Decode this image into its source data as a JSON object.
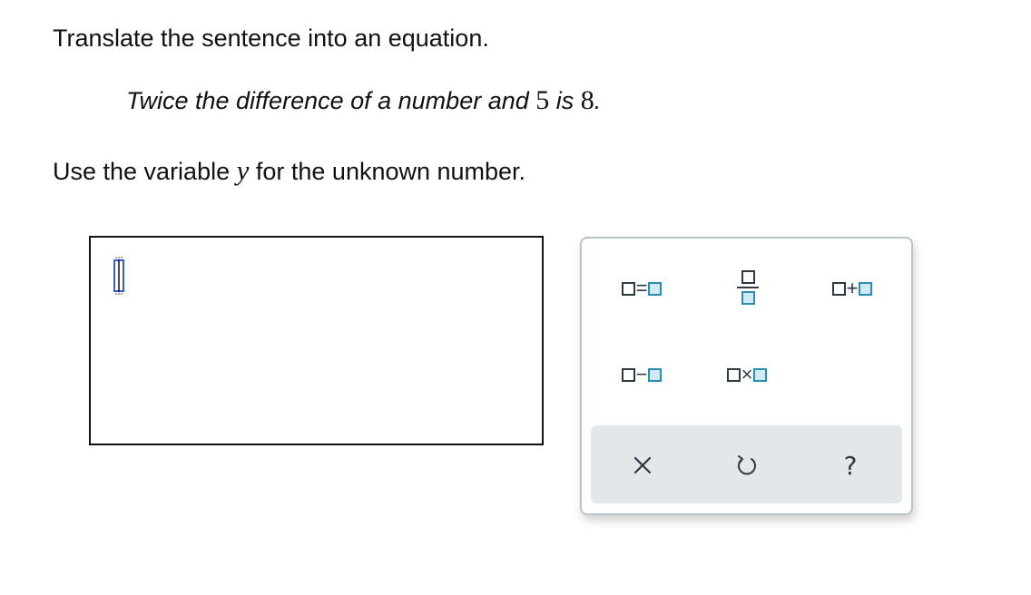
{
  "question": {
    "instruction": "Translate the sentence into an equation.",
    "sentence": {
      "part1": "Twice the difference of a number and ",
      "num1": "5",
      "part2": " is ",
      "num2": "8",
      "part3": "."
    },
    "variable_instruction": {
      "part1": "Use the variable ",
      "variable": "y",
      "part2": " for the unknown number."
    }
  },
  "palette": {
    "tools": [
      {
        "name": "equals",
        "symbol": "="
      },
      {
        "name": "fraction",
        "symbol": ""
      },
      {
        "name": "plus",
        "symbol": "+"
      },
      {
        "name": "minus",
        "symbol": "−"
      },
      {
        "name": "times",
        "symbol": "×"
      }
    ],
    "actions": [
      {
        "name": "clear",
        "icon": "x-icon"
      },
      {
        "name": "undo",
        "icon": "undo-icon"
      },
      {
        "name": "help",
        "icon": "help-icon",
        "symbol": "?"
      }
    ]
  },
  "colors": {
    "box_border": "#111111",
    "palette_border": "#b8c4cc",
    "slot_blue": "#2c8cb0",
    "slot_fill": "#cfeaf3",
    "action_bar": "#e3e7ea",
    "cursor_blue": "#3a5bd9"
  }
}
